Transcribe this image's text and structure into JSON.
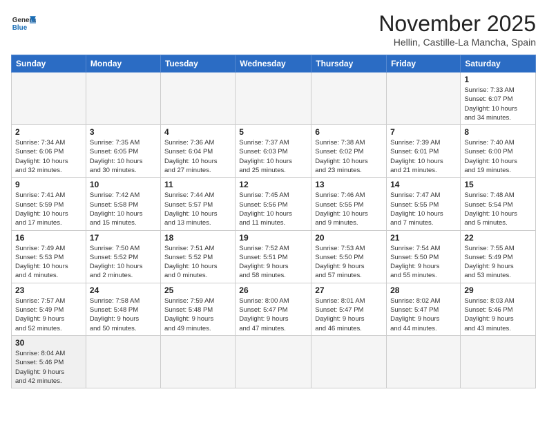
{
  "header": {
    "logo_text_general": "General",
    "logo_text_blue": "Blue",
    "month_title": "November 2025",
    "location": "Hellin, Castille-La Mancha, Spain"
  },
  "weekdays": [
    "Sunday",
    "Monday",
    "Tuesday",
    "Wednesday",
    "Thursday",
    "Friday",
    "Saturday"
  ],
  "weeks": [
    [
      {
        "day": "",
        "info": ""
      },
      {
        "day": "",
        "info": ""
      },
      {
        "day": "",
        "info": ""
      },
      {
        "day": "",
        "info": ""
      },
      {
        "day": "",
        "info": ""
      },
      {
        "day": "",
        "info": ""
      },
      {
        "day": "1",
        "info": "Sunrise: 7:33 AM\nSunset: 6:07 PM\nDaylight: 10 hours\nand 34 minutes."
      }
    ],
    [
      {
        "day": "2",
        "info": "Sunrise: 7:34 AM\nSunset: 6:06 PM\nDaylight: 10 hours\nand 32 minutes."
      },
      {
        "day": "3",
        "info": "Sunrise: 7:35 AM\nSunset: 6:05 PM\nDaylight: 10 hours\nand 30 minutes."
      },
      {
        "day": "4",
        "info": "Sunrise: 7:36 AM\nSunset: 6:04 PM\nDaylight: 10 hours\nand 27 minutes."
      },
      {
        "day": "5",
        "info": "Sunrise: 7:37 AM\nSunset: 6:03 PM\nDaylight: 10 hours\nand 25 minutes."
      },
      {
        "day": "6",
        "info": "Sunrise: 7:38 AM\nSunset: 6:02 PM\nDaylight: 10 hours\nand 23 minutes."
      },
      {
        "day": "7",
        "info": "Sunrise: 7:39 AM\nSunset: 6:01 PM\nDaylight: 10 hours\nand 21 minutes."
      },
      {
        "day": "8",
        "info": "Sunrise: 7:40 AM\nSunset: 6:00 PM\nDaylight: 10 hours\nand 19 minutes."
      }
    ],
    [
      {
        "day": "9",
        "info": "Sunrise: 7:41 AM\nSunset: 5:59 PM\nDaylight: 10 hours\nand 17 minutes."
      },
      {
        "day": "10",
        "info": "Sunrise: 7:42 AM\nSunset: 5:58 PM\nDaylight: 10 hours\nand 15 minutes."
      },
      {
        "day": "11",
        "info": "Sunrise: 7:44 AM\nSunset: 5:57 PM\nDaylight: 10 hours\nand 13 minutes."
      },
      {
        "day": "12",
        "info": "Sunrise: 7:45 AM\nSunset: 5:56 PM\nDaylight: 10 hours\nand 11 minutes."
      },
      {
        "day": "13",
        "info": "Sunrise: 7:46 AM\nSunset: 5:55 PM\nDaylight: 10 hours\nand 9 minutes."
      },
      {
        "day": "14",
        "info": "Sunrise: 7:47 AM\nSunset: 5:55 PM\nDaylight: 10 hours\nand 7 minutes."
      },
      {
        "day": "15",
        "info": "Sunrise: 7:48 AM\nSunset: 5:54 PM\nDaylight: 10 hours\nand 5 minutes."
      }
    ],
    [
      {
        "day": "16",
        "info": "Sunrise: 7:49 AM\nSunset: 5:53 PM\nDaylight: 10 hours\nand 4 minutes."
      },
      {
        "day": "17",
        "info": "Sunrise: 7:50 AM\nSunset: 5:52 PM\nDaylight: 10 hours\nand 2 minutes."
      },
      {
        "day": "18",
        "info": "Sunrise: 7:51 AM\nSunset: 5:52 PM\nDaylight: 10 hours\nand 0 minutes."
      },
      {
        "day": "19",
        "info": "Sunrise: 7:52 AM\nSunset: 5:51 PM\nDaylight: 9 hours\nand 58 minutes."
      },
      {
        "day": "20",
        "info": "Sunrise: 7:53 AM\nSunset: 5:50 PM\nDaylight: 9 hours\nand 57 minutes."
      },
      {
        "day": "21",
        "info": "Sunrise: 7:54 AM\nSunset: 5:50 PM\nDaylight: 9 hours\nand 55 minutes."
      },
      {
        "day": "22",
        "info": "Sunrise: 7:55 AM\nSunset: 5:49 PM\nDaylight: 9 hours\nand 53 minutes."
      }
    ],
    [
      {
        "day": "23",
        "info": "Sunrise: 7:57 AM\nSunset: 5:49 PM\nDaylight: 9 hours\nand 52 minutes."
      },
      {
        "day": "24",
        "info": "Sunrise: 7:58 AM\nSunset: 5:48 PM\nDaylight: 9 hours\nand 50 minutes."
      },
      {
        "day": "25",
        "info": "Sunrise: 7:59 AM\nSunset: 5:48 PM\nDaylight: 9 hours\nand 49 minutes."
      },
      {
        "day": "26",
        "info": "Sunrise: 8:00 AM\nSunset: 5:47 PM\nDaylight: 9 hours\nand 47 minutes."
      },
      {
        "day": "27",
        "info": "Sunrise: 8:01 AM\nSunset: 5:47 PM\nDaylight: 9 hours\nand 46 minutes."
      },
      {
        "day": "28",
        "info": "Sunrise: 8:02 AM\nSunset: 5:47 PM\nDaylight: 9 hours\nand 44 minutes."
      },
      {
        "day": "29",
        "info": "Sunrise: 8:03 AM\nSunset: 5:46 PM\nDaylight: 9 hours\nand 43 minutes."
      }
    ],
    [
      {
        "day": "30",
        "info": "Sunrise: 8:04 AM\nSunset: 5:46 PM\nDaylight: 9 hours\nand 42 minutes."
      },
      {
        "day": "",
        "info": ""
      },
      {
        "day": "",
        "info": ""
      },
      {
        "day": "",
        "info": ""
      },
      {
        "day": "",
        "info": ""
      },
      {
        "day": "",
        "info": ""
      },
      {
        "day": "",
        "info": ""
      }
    ]
  ]
}
